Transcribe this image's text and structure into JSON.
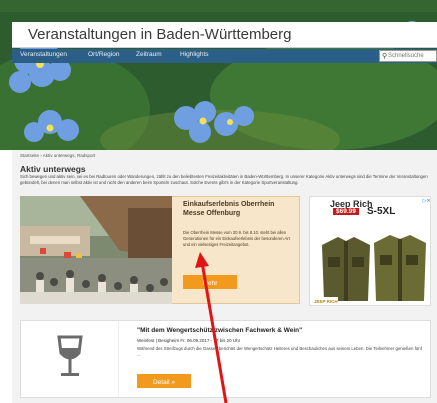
{
  "header": {
    "site_title": "Veranstaltungen in Baden-Württemberg"
  },
  "nav": {
    "items": [
      "Veranstaltungen",
      "Ort/Region",
      "Zeitraum",
      "Highlights"
    ],
    "search_placeholder": "Schnellsuche"
  },
  "page": {
    "breadcrumb": "Startseite › Aktiv unterwegs, Radsport",
    "title": "Aktiv unterwegs",
    "intro": "Sich bewegen und aktiv sein, sei es bei Radtouren oder Wanderungen, zählt zu den beliebtesten Freizeitaktivitäten in Baden-Württemberg. In unserer Kategorie Aktiv unterwegs sind die Termine der Veranstaltungen gebündelt, bei denen man selbst aktiv ist und nicht den anderen beim Sporteln zuschaut. Solche Events gibt's in der Kategorie Sportveranstaltung."
  },
  "featured_event": {
    "title_line1": "Einkaufserlebnis Oberrhein",
    "title_line2": "Messe Offenburg",
    "text": "Die Oberrhein Messe vom 30.9. bis 8.10. steht bei allen Generationen für ein Einkaufserlebnis der besonderen Art und ein vielseitiges Freizeitangebot.",
    "button_label": "Mehr"
  },
  "ad": {
    "brand": "Jeep Rich",
    "price": "$69.99",
    "size": "S-5XL",
    "badge": "▷✕"
  },
  "event2": {
    "title": "\"Mit dem Wengertschütz zwischen Fachwerk & Wein\"",
    "meta": "Weinfest | Besigheim Fr, 06.09.2017 - 17 bis 20 Uhr",
    "description": "Während des Streifzugs durch die Gassen berichtet der Wengertschütz Heiteres und Beschauliches aus seinem Leben. Die Teilnehmer genießen fünf ...",
    "button_label": "Detail »"
  },
  "colors": {
    "nav_bg": "#2c5f87",
    "button_orange": "#f29a1e",
    "card_bg": "#f7e6c9",
    "annotation_arrow": "#e01414"
  },
  "icons": {
    "search": "search-icon",
    "wine_glass": "wine-glass-icon",
    "ad_choices": "ad-choices-icon"
  }
}
